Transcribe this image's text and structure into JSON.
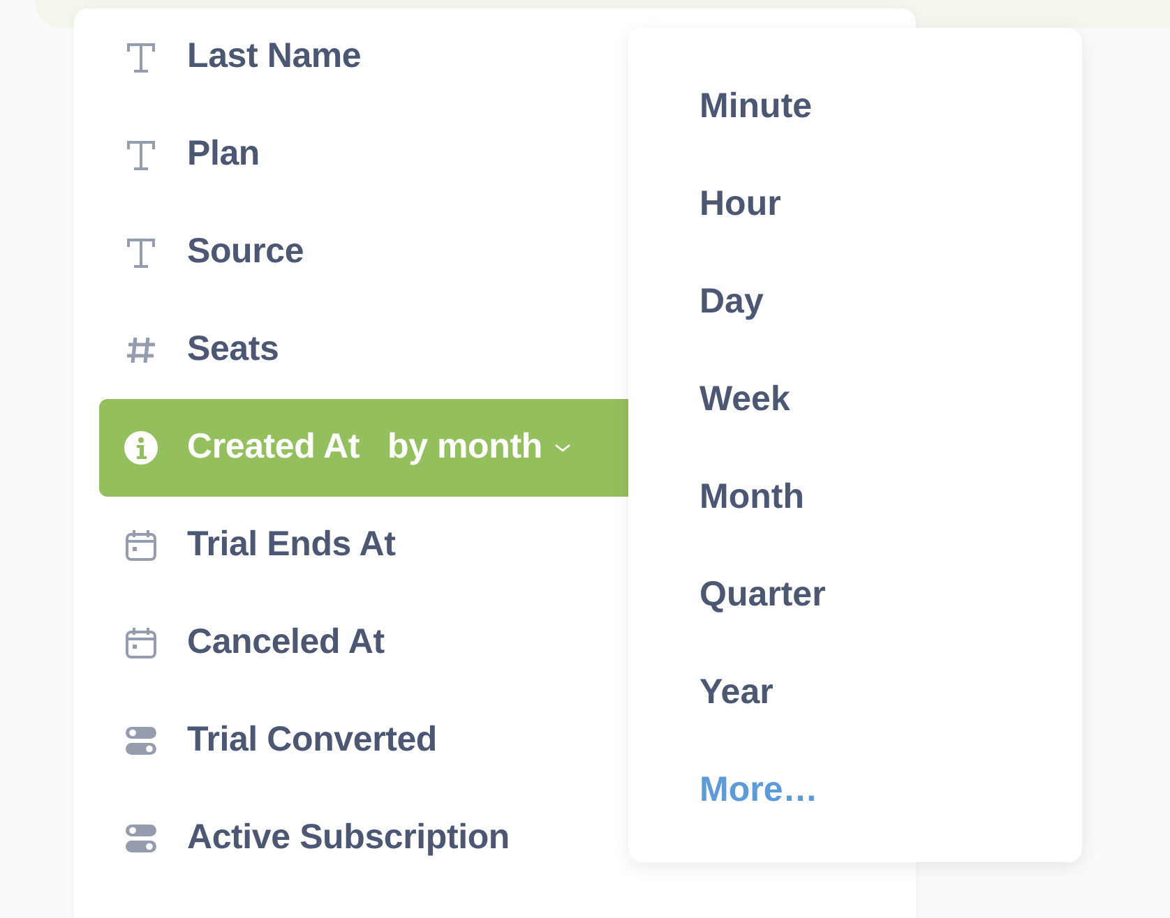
{
  "fields": [
    {
      "kind": "text",
      "label": "Last Name",
      "selected": false
    },
    {
      "kind": "text",
      "label": "Plan",
      "selected": false
    },
    {
      "kind": "text",
      "label": "Source",
      "selected": false
    },
    {
      "kind": "number",
      "label": "Seats",
      "selected": false
    },
    {
      "kind": "info",
      "label": "Created At",
      "selected": true,
      "bucket": "by month"
    },
    {
      "kind": "date",
      "label": "Trial Ends At",
      "selected": false
    },
    {
      "kind": "date",
      "label": "Canceled At",
      "selected": false
    },
    {
      "kind": "boolean",
      "label": "Trial Converted",
      "selected": false
    },
    {
      "kind": "boolean",
      "label": "Active Subscription",
      "selected": false
    }
  ],
  "bucket_menu": [
    {
      "kind": "option",
      "label": "Minute"
    },
    {
      "kind": "option",
      "label": "Hour"
    },
    {
      "kind": "option",
      "label": "Day"
    },
    {
      "kind": "option",
      "label": "Week"
    },
    {
      "kind": "option",
      "label": "Month"
    },
    {
      "kind": "option",
      "label": "Quarter"
    },
    {
      "kind": "option",
      "label": "Year"
    },
    {
      "kind": "link",
      "label": "More…"
    }
  ]
}
